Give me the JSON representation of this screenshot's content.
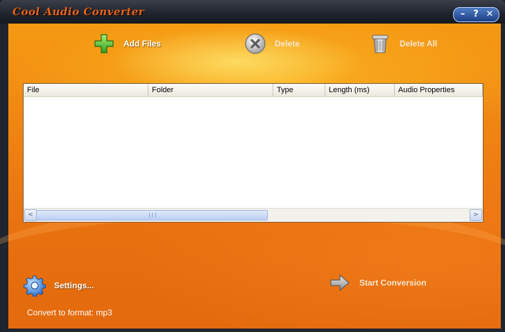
{
  "app": {
    "title": "Cool Audio Converter",
    "window_controls": {
      "minimize": "–",
      "help": "?",
      "close": "✕"
    }
  },
  "toolbar": {
    "add_files": {
      "label": "Add Files",
      "icon": "plus-icon"
    },
    "delete": {
      "label": "Delete",
      "icon": "delete-circle-icon"
    },
    "delete_all": {
      "label": "Delete All",
      "icon": "trash-can-icon"
    }
  },
  "file_table": {
    "columns": [
      "File",
      "Folder",
      "Type",
      "Length (ms)",
      "Audio Properties"
    ],
    "rows": []
  },
  "scrollbar": {
    "left_arrow": "<",
    "right_arrow": ">"
  },
  "settings": {
    "label": "Settings...",
    "icon": "gear-icon"
  },
  "start_conversion": {
    "label": "Start Conversion",
    "icon": "arrow-right-icon"
  },
  "status": {
    "convert_format_text": "Convert to format: mp3"
  },
  "colors": {
    "accent": "#f08a15",
    "title_text": "#e8641a",
    "window_frame": "#20242e"
  }
}
